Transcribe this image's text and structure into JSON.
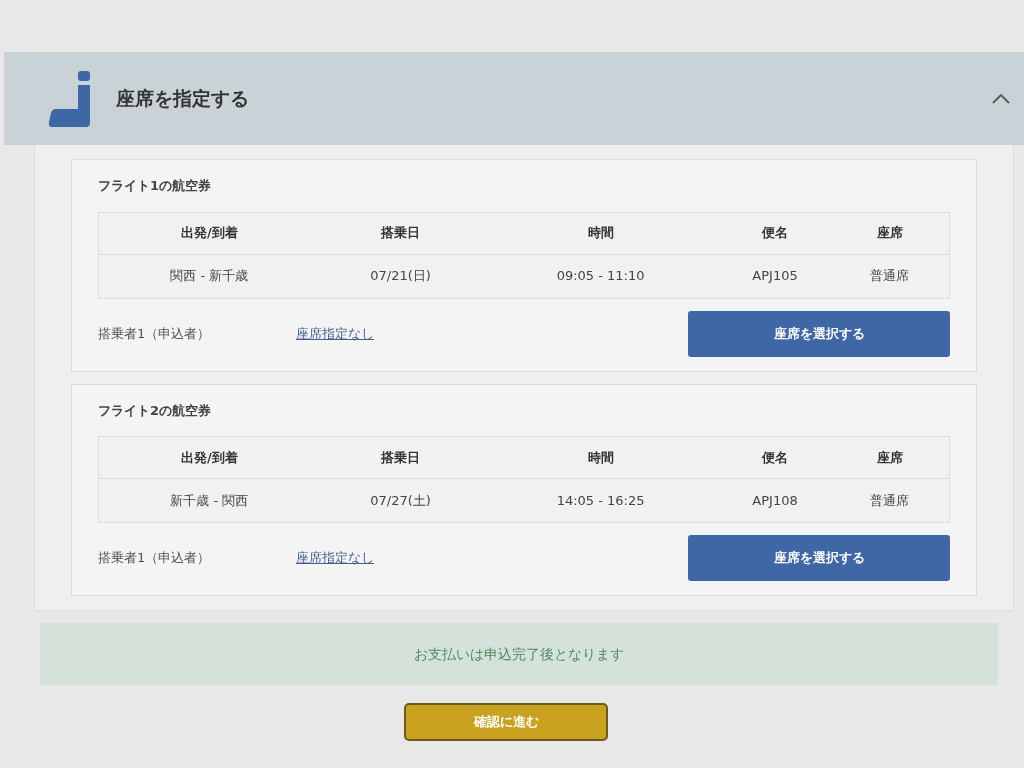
{
  "section": {
    "title": "座席を指定する",
    "expanded": true
  },
  "flights": [
    {
      "title": "フライト1の航空券",
      "columns": [
        "出発/到着",
        "搭乗日",
        "時間",
        "便名",
        "座席"
      ],
      "rows": [
        [
          "関西 - 新千歳",
          "07/21(日)",
          "09:05 - 11:10",
          "APJ105",
          "普通席"
        ]
      ],
      "passengers": [
        {
          "label": "搭乗者1（申込者）",
          "seat": "座席指定なし",
          "button": "座席を選択する"
        }
      ]
    },
    {
      "title": "フライト2の航空券",
      "columns": [
        "出発/到着",
        "搭乗日",
        "時間",
        "便名",
        "座席"
      ],
      "rows": [
        [
          "新千歳 - 関西",
          "07/27(土)",
          "14:05 - 16:25",
          "APJ108",
          "普通席"
        ]
      ],
      "passengers": [
        {
          "label": "搭乗者1（申込者）",
          "seat": "座席指定なし",
          "button": "座席を選択する"
        }
      ]
    }
  ],
  "notice": "お支払いは申込完了後となります",
  "next_button": "確認に進む"
}
